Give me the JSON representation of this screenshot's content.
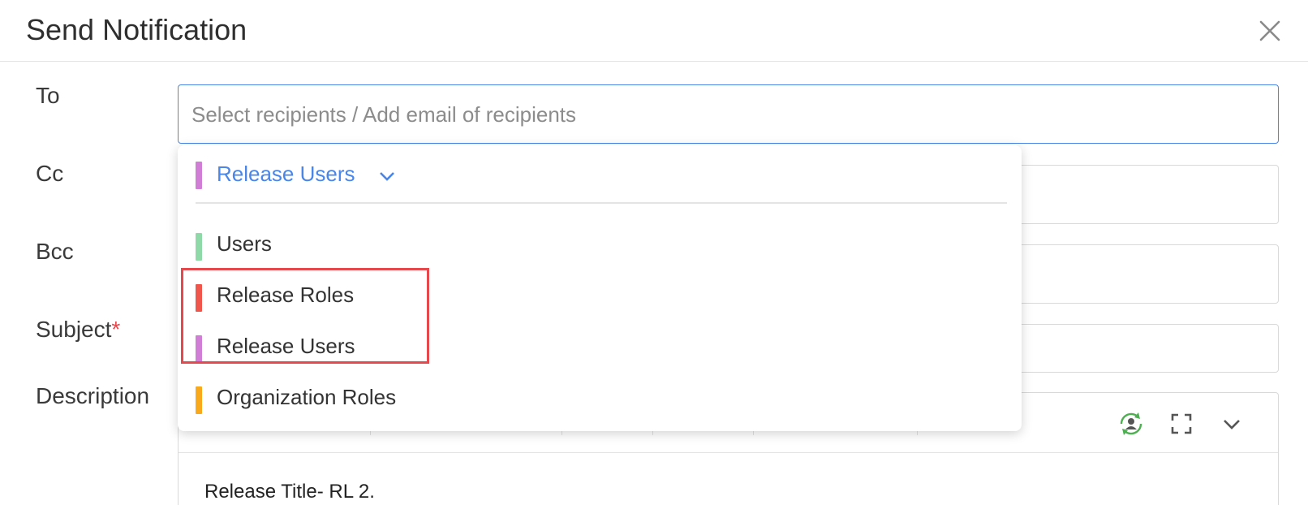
{
  "dialog": {
    "title": "Send Notification"
  },
  "form": {
    "to_label": "To",
    "cc_label": "Cc",
    "bcc_label": "Bcc",
    "subject_label": "Subject",
    "subject_required_mark": "*",
    "description_label": "Description",
    "to_placeholder": "Select recipients / Add email of recipients"
  },
  "dropdown": {
    "header": {
      "label": "Release Users",
      "color": "#d17fd6",
      "icon": "chevron-down-icon"
    },
    "options": [
      {
        "label": "Users",
        "color": "#8fd9a8"
      },
      {
        "label": "Release Roles",
        "color": "#f0564b"
      },
      {
        "label": "Release Users",
        "color": "#d17fd6"
      },
      {
        "label": "Organization Roles",
        "color": "#f8aa1c"
      }
    ]
  },
  "editor": {
    "toolbar_icons": [
      "user-sync-icon",
      "fullscreen-icon",
      "chevron-down-icon"
    ],
    "content": "Release Title- RL 2."
  },
  "colors": {
    "accent": "#4a86e8",
    "required": "#e5484d",
    "highlight": "#e5484d"
  }
}
